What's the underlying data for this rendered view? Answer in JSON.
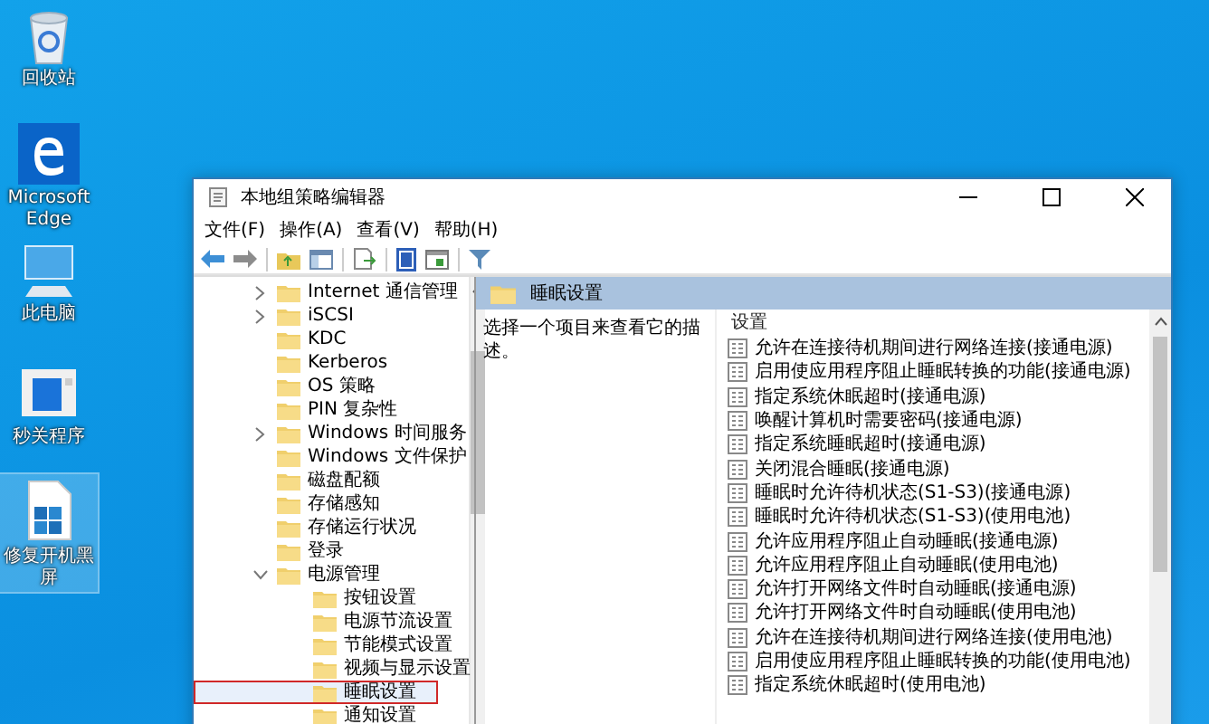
{
  "desktop_icons": [
    {
      "label": "回收站",
      "kind": "recycle",
      "selected": false
    },
    {
      "label": "Microsoft Edge",
      "kind": "edge",
      "selected": false
    },
    {
      "label": "此电脑",
      "kind": "computer",
      "selected": false
    },
    {
      "label": "秒关程序",
      "kind": "app",
      "selected": false
    },
    {
      "label": "修复开机黑屏",
      "kind": "registry",
      "selected": true
    }
  ],
  "window": {
    "title": "本地组策略编辑器"
  },
  "menu": [
    "文件(F)",
    "操作(A)",
    "查看(V)",
    "帮助(H)"
  ],
  "tree": [
    {
      "label": "Internet 通信管理",
      "expanded": false,
      "selected": false
    },
    {
      "label": "iSCSI",
      "expanded": false,
      "selected": false
    },
    {
      "label": "KDC",
      "selected": false
    },
    {
      "label": "Kerberos",
      "selected": false
    },
    {
      "label": "OS 策略",
      "selected": false
    },
    {
      "label": "PIN 复杂性",
      "selected": false
    },
    {
      "label": "Windows 时间服务",
      "expanded": false,
      "selected": false
    },
    {
      "label": "Windows 文件保护",
      "selected": false
    },
    {
      "label": "磁盘配额",
      "selected": false
    },
    {
      "label": "存储感知",
      "selected": false
    },
    {
      "label": "存储运行状况",
      "selected": false
    },
    {
      "label": "登录",
      "selected": false
    },
    {
      "label": "电源管理",
      "expanded": true,
      "selected": false,
      "children": [
        {
          "label": "按钮设置",
          "selected": false
        },
        {
          "label": "电源节流设置",
          "selected": false
        },
        {
          "label": "节能模式设置",
          "selected": false
        },
        {
          "label": "视频与显示设置",
          "selected": false
        },
        {
          "label": "睡眠设置",
          "selected": true
        },
        {
          "label": "通知设置",
          "selected": false
        }
      ]
    }
  ],
  "detail": {
    "header": "睡眠设置",
    "description": "选择一个项目来查看它的描述。",
    "column": "设置",
    "settings": [
      "允许在连接待机期间进行网络连接(接通电源)",
      "启用使应用程序阻止睡眠转换的功能(接通电源)",
      "指定系统休眠超时(接通电源)",
      "唤醒计算机时需要密码(接通电源)",
      "指定系统睡眠超时(接通电源)",
      "关闭混合睡眠(接通电源)",
      "睡眠时允许待机状态(S1-S3)(接通电源)",
      "睡眠时允许待机状态(S1-S3)(使用电池)",
      "允许应用程序阻止自动睡眠(接通电源)",
      "允许应用程序阻止自动睡眠(使用电池)",
      "允许打开网络文件时自动睡眠(接通电源)",
      "允许打开网络文件时自动睡眠(使用电池)",
      "允许在连接待机期间进行网络连接(使用电池)",
      "启用使应用程序阻止睡眠转换的功能(使用电池)",
      "指定系统休眠超时(使用电池)"
    ]
  }
}
